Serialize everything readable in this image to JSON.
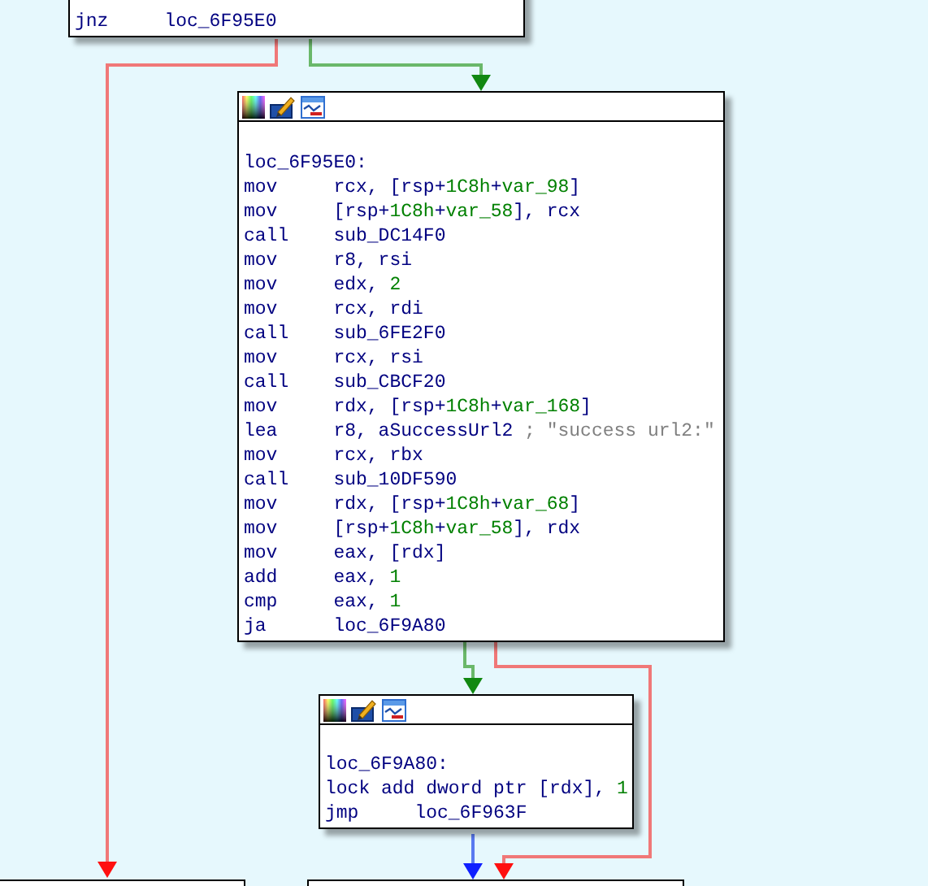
{
  "nodes": [
    {
      "header": false,
      "lines": [
        {
          "kind": "insn",
          "mnemonic": "jnz",
          "operands": [
            {
              "kind": "plain",
              "text": "loc_6F95E0"
            }
          ]
        }
      ]
    },
    {
      "header": true,
      "lines": [
        {
          "kind": "label",
          "text": "loc_6F95E0:"
        },
        {
          "kind": "insn",
          "mnemonic": "mov",
          "operands": [
            {
              "kind": "plain",
              "text": "rcx, [rsp+"
            },
            {
              "kind": "num",
              "text": "1C8h"
            },
            {
              "kind": "plain",
              "text": "+"
            },
            {
              "kind": "num",
              "text": "var_98"
            },
            {
              "kind": "plain",
              "text": "]"
            }
          ]
        },
        {
          "kind": "insn",
          "mnemonic": "mov",
          "operands": [
            {
              "kind": "plain",
              "text": "[rsp+"
            },
            {
              "kind": "num",
              "text": "1C8h"
            },
            {
              "kind": "plain",
              "text": "+"
            },
            {
              "kind": "num",
              "text": "var_58"
            },
            {
              "kind": "plain",
              "text": "], rcx"
            }
          ]
        },
        {
          "kind": "insn",
          "mnemonic": "call",
          "operands": [
            {
              "kind": "plain",
              "text": "sub_DC14F0"
            }
          ]
        },
        {
          "kind": "insn",
          "mnemonic": "mov",
          "operands": [
            {
              "kind": "plain",
              "text": "r8, rsi"
            }
          ]
        },
        {
          "kind": "insn",
          "mnemonic": "mov",
          "operands": [
            {
              "kind": "plain",
              "text": "edx, "
            },
            {
              "kind": "num",
              "text": "2"
            }
          ]
        },
        {
          "kind": "insn",
          "mnemonic": "mov",
          "operands": [
            {
              "kind": "plain",
              "text": "rcx, rdi"
            }
          ]
        },
        {
          "kind": "insn",
          "mnemonic": "call",
          "operands": [
            {
              "kind": "plain",
              "text": "sub_6FE2F0"
            }
          ]
        },
        {
          "kind": "insn",
          "mnemonic": "mov",
          "operands": [
            {
              "kind": "plain",
              "text": "rcx, rsi"
            }
          ]
        },
        {
          "kind": "insn",
          "mnemonic": "call",
          "operands": [
            {
              "kind": "plain",
              "text": "sub_CBCF20"
            }
          ]
        },
        {
          "kind": "insn",
          "mnemonic": "mov",
          "operands": [
            {
              "kind": "plain",
              "text": "rdx, [rsp+"
            },
            {
              "kind": "num",
              "text": "1C8h"
            },
            {
              "kind": "plain",
              "text": "+"
            },
            {
              "kind": "num",
              "text": "var_168"
            },
            {
              "kind": "plain",
              "text": "]"
            }
          ]
        },
        {
          "kind": "insn",
          "mnemonic": "lea",
          "operands": [
            {
              "kind": "plain",
              "text": "r8, aSuccessUrl2 "
            },
            {
              "kind": "comment",
              "text": "; \"success url2:\""
            }
          ]
        },
        {
          "kind": "insn",
          "mnemonic": "mov",
          "operands": [
            {
              "kind": "plain",
              "text": "rcx, rbx"
            }
          ]
        },
        {
          "kind": "insn",
          "mnemonic": "call",
          "operands": [
            {
              "kind": "plain",
              "text": "sub_10DF590"
            }
          ]
        },
        {
          "kind": "insn",
          "mnemonic": "mov",
          "operands": [
            {
              "kind": "plain",
              "text": "rdx, [rsp+"
            },
            {
              "kind": "num",
              "text": "1C8h"
            },
            {
              "kind": "plain",
              "text": "+"
            },
            {
              "kind": "num",
              "text": "var_68"
            },
            {
              "kind": "plain",
              "text": "]"
            }
          ]
        },
        {
          "kind": "insn",
          "mnemonic": "mov",
          "operands": [
            {
              "kind": "plain",
              "text": "[rsp+"
            },
            {
              "kind": "num",
              "text": "1C8h"
            },
            {
              "kind": "plain",
              "text": "+"
            },
            {
              "kind": "num",
              "text": "var_58"
            },
            {
              "kind": "plain",
              "text": "], rdx"
            }
          ]
        },
        {
          "kind": "insn",
          "mnemonic": "mov",
          "operands": [
            {
              "kind": "plain",
              "text": "eax, [rdx]"
            }
          ]
        },
        {
          "kind": "insn",
          "mnemonic": "add",
          "operands": [
            {
              "kind": "plain",
              "text": "eax, "
            },
            {
              "kind": "num",
              "text": "1"
            }
          ]
        },
        {
          "kind": "insn",
          "mnemonic": "cmp",
          "operands": [
            {
              "kind": "plain",
              "text": "eax, "
            },
            {
              "kind": "num",
              "text": "1"
            }
          ]
        },
        {
          "kind": "insn",
          "mnemonic": "ja",
          "operands": [
            {
              "kind": "plain",
              "text": "loc_6F9A80"
            }
          ]
        }
      ]
    },
    {
      "header": true,
      "lines": [
        {
          "kind": "label",
          "text": "loc_6F9A80:"
        },
        {
          "kind": "insn",
          "mnemonic": "lock add",
          "operands": [
            {
              "kind": "plain",
              "text": "dword ptr [rdx], "
            },
            {
              "kind": "num",
              "text": "1"
            }
          ]
        },
        {
          "kind": "insn",
          "mnemonic": "jmp",
          "operands": [
            {
              "kind": "plain",
              "text": "loc_6F963F"
            }
          ]
        }
      ]
    }
  ],
  "edges": [
    {
      "kind": "false"
    },
    {
      "kind": "true"
    },
    {
      "kind": "true"
    },
    {
      "kind": "false"
    },
    {
      "kind": "jump"
    }
  ]
}
